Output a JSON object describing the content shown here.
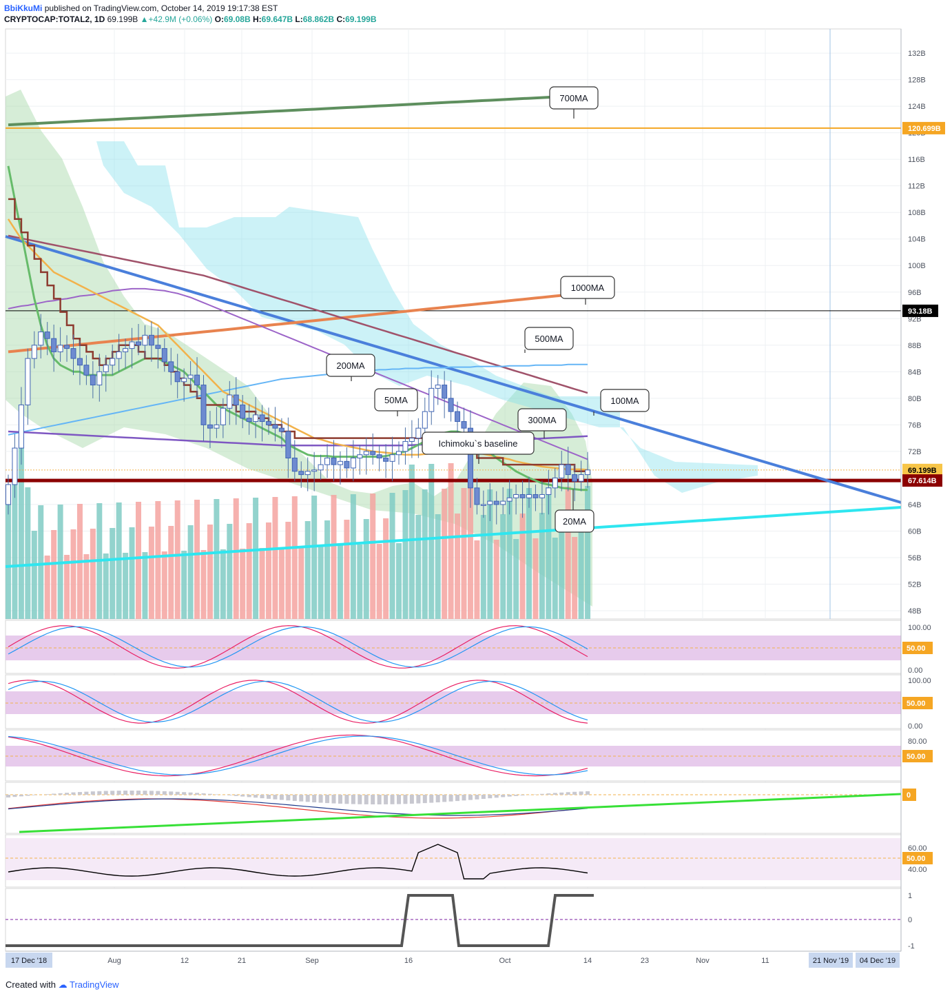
{
  "header": {
    "author": "BbiKkuMi",
    "published": "published on TradingView.com, October 14, 2019 19:17:38 EST",
    "symbol": "CRYPTOCAP:TOTAL2, 1D",
    "last": "69.199B",
    "change": "▲+42.9M (+0.06%)",
    "o_label": "O:",
    "o": "69.08B",
    "h_label": "H:",
    "h": "69.647B",
    "l_label": "L:",
    "l": "68.862B",
    "c_label": "C:",
    "c": "69.199B"
  },
  "footer": {
    "created_with": "Created with",
    "brand": "TradingView"
  },
  "colors": {
    "up": "#26a69a",
    "down": "#ef5350",
    "ma700": "#5e8f5e",
    "ma1000": "#e8834f",
    "ma500": "#a0526a",
    "ma200": "#64b5f6",
    "ma300": "#7e57c2",
    "ma100": "#9c64c8",
    "ma50": "#f2b24b",
    "ma20": "#66bb6a",
    "baseline": "#8d3b2f",
    "trend_blue": "#4a7fdb",
    "trend_cyan": "#2ee6f0",
    "trend_green": "#37e037",
    "orange_line": "#f5a623",
    "red_line": "#8b0000",
    "band": "#e1bee7"
  },
  "chart_data": {
    "type": "line",
    "y_axis_ticks": [
      "132B",
      "128B",
      "124B",
      "120B",
      "116B",
      "112B",
      "108B",
      "104B",
      "100B",
      "96B",
      "92B",
      "88B",
      "84B",
      "80B",
      "76B",
      "72B",
      "68B",
      "64B",
      "60B",
      "56B",
      "52B",
      "48B"
    ],
    "ylim": [
      47,
      133
    ],
    "x_axis_ticks": [
      "Aug",
      "12",
      "21",
      "Sep",
      "16",
      "Oct",
      "14",
      "23",
      "Nov",
      "11"
    ],
    "x_axis_boxes": [
      "17 Dec '18",
      "21 Nov '19",
      "04 Dec '19"
    ],
    "price_labels": {
      "horizontal_orange": "120.699B",
      "horizontal_black": "93.18B",
      "last_price": "69.199B",
      "horizontal_red": "67.614B"
    },
    "price_levels": {
      "horizontal_orange": 120.699,
      "horizontal_black": 93.18,
      "last_price": 69.199,
      "horizontal_red": 67.614
    },
    "annotations": [
      "700MA",
      "1000MA",
      "500MA",
      "200MA",
      "50MA",
      "100MA",
      "300MA",
      "Ichimoku`s baseline",
      "20MA"
    ],
    "close": [
      67.0,
      72.5,
      79.0,
      86.0,
      88.0,
      90.0,
      89.0,
      87.0,
      88.0,
      87.5,
      86.0,
      85.0,
      83.5,
      82.0,
      84.0,
      85.0,
      86.0,
      87.0,
      87.5,
      88.5,
      88.0,
      89.5,
      88.0,
      87.5,
      85.5,
      84.0,
      82.5,
      83.0,
      83.5,
      82.0,
      76.0,
      75.5,
      76.0,
      78.5,
      80.5,
      79.0,
      77.0,
      76.5,
      77.5,
      76.5,
      76.0,
      75.5,
      75.0,
      71.0,
      69.0,
      68.5,
      69.0,
      69.2,
      70.0,
      71.0,
      70.0,
      70.5,
      69.5,
      71.0,
      71.5,
      72.0,
      71.5,
      71.0,
      70.5,
      71.5,
      72.0,
      73.5,
      74.0,
      75.5,
      78.0,
      81.5,
      82.0,
      80.0,
      78.0,
      76.5,
      75.5,
      66.5,
      64.0,
      64.0,
      64.5,
      64.0,
      64.5,
      65.0,
      65.5,
      65.0,
      65.5,
      65.0,
      65.5,
      66.5,
      68.0,
      70.0,
      68.5,
      67.5,
      68.5,
      69.2
    ],
    "ma20": [
      115,
      110,
      105,
      100,
      95,
      91,
      88,
      86,
      85,
      84.5,
      84,
      84,
      83.5,
      83.5,
      83.5,
      83.5,
      83.5,
      84,
      84.5,
      85,
      85.5,
      86,
      86,
      86,
      85.5,
      85,
      84.5,
      84,
      83,
      82,
      81,
      80,
      79,
      78.5,
      78,
      77.5,
      77,
      76.5,
      76,
      75.5,
      75,
      74.5,
      74,
      73,
      72.5,
      72,
      71.5,
      71.3,
      71.3,
      71.3,
      71.2,
      71.2,
      71.2,
      71.2,
      71.2,
      71.2,
      71.2,
      71.2,
      71.3,
      71.5,
      71.8,
      72,
      72.5,
      73,
      73.5,
      74,
      74.5,
      74.8,
      75,
      75,
      74.7,
      74,
      73.3,
      72.5,
      71.8,
      71,
      70.3,
      69.7,
      69,
      68.5,
      68,
      67.6,
      67.2,
      67,
      66.8,
      66.5,
      66.4,
      66.3,
      66.2,
      66.2
    ],
    "ma50": [
      107,
      105.5,
      104,
      103,
      102,
      101,
      100,
      99,
      98.5,
      98,
      97.5,
      97,
      96.5,
      96,
      95.5,
      95,
      94.5,
      94,
      93.5,
      93,
      92.5,
      92,
      91.5,
      91,
      90,
      89,
      88,
      87,
      86,
      85,
      84,
      83,
      82,
      81,
      80.5,
      80,
      79.5,
      79,
      78.5,
      78,
      77.5,
      77,
      76.5,
      76,
      75.5,
      75,
      74.5,
      74,
      73.8,
      73.5,
      73.2,
      73,
      72.8,
      72.6,
      72.4,
      72.2,
      72,
      71.9,
      71.8,
      71.7,
      71.6,
      71.5,
      71.5,
      71.5,
      71.6,
      71.7,
      71.8,
      71.9,
      72,
      72,
      72,
      71.9,
      71.8,
      71.6,
      71.4,
      71.2,
      71,
      70.8,
      70.5,
      70.3,
      70.1,
      69.9,
      69.7,
      69.6,
      69.5,
      69.4,
      69.3,
      69.3,
      69.3,
      69.2
    ],
    "ma100": [
      93.5,
      93.7,
      93.9,
      94,
      94.2,
      94.4,
      94.6,
      94.7,
      94.9,
      95,
      95.2,
      95.4,
      95.5,
      95.6,
      95.8,
      96,
      96.2,
      96.3,
      96.4,
      96.5,
      96.5,
      96.5,
      96.4,
      96.3,
      96.2,
      96,
      95.8,
      95.5,
      95.2,
      94.8,
      94.4,
      94,
      93.6,
      93.2,
      92.8,
      92.4,
      92,
      91.6,
      91.2,
      90.8,
      90.4,
      90,
      89.6,
      89.2,
      88.8,
      88.4,
      88,
      87.6,
      87.2,
      86.8,
      86.4,
      86,
      85.6,
      85.2,
      84.8,
      84.4,
      84,
      83.6,
      83.2,
      82.8,
      82.4,
      82,
      81.6,
      81.2,
      80.8,
      80.4,
      80,
      79.6,
      79.2,
      78.8,
      78.4,
      78,
      77.6,
      77.2,
      76.8,
      76.4,
      76,
      75.6,
      75.2,
      74.8,
      74.4,
      74,
      73.6,
      73.2,
      72.8,
      72.4,
      72,
      71.6,
      71.2,
      70.8
    ],
    "ma200": [
      74.5,
      74.7,
      74.9,
      75.1,
      75.3,
      75.5,
      75.7,
      75.9,
      76.1,
      76.3,
      76.5,
      76.7,
      76.9,
      77.1,
      77.3,
      77.5,
      77.7,
      77.9,
      78.1,
      78.3,
      78.5,
      78.7,
      78.9,
      79.1,
      79.3,
      79.5,
      79.7,
      79.9,
      80.1,
      80.3,
      80.5,
      80.7,
      80.9,
      81.1,
      81.3,
      81.5,
      81.7,
      81.9,
      82.1,
      82.3,
      82.5,
      82.7,
      82.9,
      83.0,
      83.1,
      83.2,
      83.3,
      83.4,
      83.5,
      83.6,
      83.7,
      83.8,
      83.9,
      84.0,
      84.1,
      84.2,
      84.2,
      84.3,
      84.3,
      84.4,
      84.4,
      84.5,
      84.5,
      84.5,
      84.6,
      84.6,
      84.6,
      84.6,
      84.7,
      84.7,
      84.7,
      84.7,
      84.8,
      84.8,
      84.8,
      84.8,
      84.8,
      84.9,
      84.9,
      84.9,
      84.9,
      85.0,
      85.0,
      85.0,
      85.0,
      85.0,
      85.1,
      85.1,
      85.1,
      85.1
    ],
    "ma300": [
      75.0,
      74.95,
      74.9,
      74.85,
      74.8,
      74.75,
      74.7,
      74.65,
      74.6,
      74.55,
      74.5,
      74.45,
      74.4,
      74.35,
      74.3,
      74.25,
      74.2,
      74.15,
      74.1,
      74.05,
      74.0,
      73.95,
      73.9,
      73.85,
      73.8,
      73.75,
      73.7,
      73.65,
      73.6,
      73.55,
      73.5,
      73.45,
      73.4,
      73.35,
      73.3,
      73.25,
      73.2,
      73.15,
      73.1,
      73.05,
      73.0,
      72.95,
      72.9,
      72.9,
      72.9,
      72.9,
      72.9,
      72.9,
      72.9,
      72.9,
      72.9,
      72.9,
      72.9,
      72.9,
      72.9,
      72.9,
      72.9,
      72.9,
      72.9,
      72.9,
      72.9,
      72.9,
      72.95,
      73.0,
      73.05,
      73.1,
      73.15,
      73.2,
      73.25,
      73.3,
      73.35,
      73.4,
      73.45,
      73.5,
      73.55,
      73.6,
      73.65,
      73.7,
      73.75,
      73.8,
      73.85,
      73.9,
      73.95,
      74.0,
      74.05,
      74.1,
      74.15,
      74.2,
      74.25,
      74.3
    ],
    "ma500": [
      104.5,
      104.3,
      104.1,
      103.9,
      103.7,
      103.5,
      103.3,
      103.1,
      102.9,
      102.7,
      102.5,
      102.3,
      102.1,
      101.9,
      101.7,
      101.5,
      101.3,
      101.1,
      100.9,
      100.7,
      100.5,
      100.3,
      100.1,
      99.9,
      99.7,
      99.5,
      99.3,
      99.1,
      98.9,
      98.7,
      98.5,
      98.2,
      97.9,
      97.6,
      97.3,
      97.0,
      96.7,
      96.4,
      96.1,
      95.8,
      95.5,
      95.2,
      94.9,
      94.6,
      94.3,
      94.0,
      93.7,
      93.4,
      93.1,
      92.8,
      92.5,
      92.2,
      91.9,
      91.6,
      91.3,
      91.0,
      90.7,
      90.4,
      90.1,
      89.8,
      89.5,
      89.2,
      88.9,
      88.6,
      88.3,
      88.0,
      87.7,
      87.4,
      87.1,
      86.8,
      86.5,
      86.2,
      85.9,
      85.6,
      85.3,
      85.0,
      84.7,
      84.4,
      84.1,
      83.8,
      83.5,
      83.2,
      82.9,
      82.6,
      82.3,
      82.0,
      81.7,
      81.4,
      81.1,
      80.8
    ],
    "ma700": [
      121.2,
      121.25,
      121.3,
      121.35,
      121.4,
      121.45,
      121.5,
      121.55,
      121.6,
      121.65,
      121.7,
      121.75,
      121.8,
      121.85,
      121.9,
      121.95,
      122.0,
      122.05,
      122.1,
      122.15,
      122.2,
      122.25,
      122.3,
      122.35,
      122.4,
      122.45,
      122.5,
      122.55,
      122.6,
      122.65,
      122.7,
      122.75,
      122.8,
      122.85,
      122.9,
      122.95,
      123.0,
      123.05,
      123.1,
      123.15,
      123.2,
      123.25,
      123.3,
      123.35,
      123.4,
      123.45,
      123.5,
      123.55,
      123.6,
      123.65,
      123.7,
      123.75,
      123.8,
      123.85,
      123.9,
      123.95,
      124.0,
      124.05,
      124.1,
      124.15,
      124.2,
      124.25,
      124.3,
      124.35,
      124.4,
      124.45,
      124.5,
      124.55,
      124.6,
      124.65,
      124.7,
      124.75,
      124.8,
      124.85,
      124.9,
      124.95,
      125.0,
      125.05,
      125.1,
      125.15,
      125.2,
      125.25,
      125.3,
      125.35,
      125.4,
      125.45,
      125.5,
      125.55,
      125.6,
      125.65
    ],
    "ma1000": [
      87.0,
      87.1,
      87.2,
      87.3,
      87.4,
      87.5,
      87.6,
      87.7,
      87.8,
      87.9,
      88.0,
      88.1,
      88.2,
      88.3,
      88.4,
      88.5,
      88.6,
      88.7,
      88.8,
      88.9,
      89.0,
      89.1,
      89.2,
      89.3,
      89.4,
      89.5,
      89.6,
      89.7,
      89.8,
      89.9,
      90.0,
      90.1,
      90.2,
      90.3,
      90.4,
      90.5,
      90.6,
      90.7,
      90.8,
      90.9,
      91.0,
      91.1,
      91.2,
      91.3,
      91.4,
      91.5,
      91.6,
      91.7,
      91.8,
      91.9,
      92.0,
      92.1,
      92.2,
      92.3,
      92.4,
      92.5,
      92.6,
      92.7,
      92.8,
      92.9,
      93.0,
      93.1,
      93.2,
      93.3,
      93.4,
      93.5,
      93.6,
      93.7,
      93.8,
      93.9,
      94.0,
      94.1,
      94.2,
      94.3,
      94.4,
      94.5,
      94.6,
      94.7,
      94.8,
      94.9,
      95.0,
      95.1,
      95.2,
      95.3,
      95.4,
      95.5,
      95.6,
      95.7,
      95.8,
      95.9
    ],
    "baseline": [
      110,
      107,
      105,
      103,
      101,
      99,
      97,
      95,
      93,
      91,
      89,
      88,
      87,
      86,
      85,
      86,
      87,
      88,
      88,
      88,
      87,
      86,
      86,
      86,
      85,
      84,
      83,
      82,
      81,
      80,
      79,
      79,
      79,
      79,
      79,
      78,
      78,
      78,
      77,
      77,
      76,
      76,
      75,
      75,
      74,
      74,
      74,
      74,
      74,
      74,
      74,
      74,
      74,
      74,
      74,
      74,
      74,
      74,
      74,
      74,
      74,
      74,
      74,
      74,
      74,
      74,
      73,
      73,
      73,
      72,
      72,
      72,
      71,
      71,
      71,
      71,
      70,
      70,
      70,
      70,
      70,
      70,
      70,
      70,
      70,
      70,
      70,
      69,
      69,
      69
    ],
    "oscillators": [
      {
        "labels": [
          "100.00",
          "50.00",
          "0.00"
        ]
      },
      {
        "labels": [
          "100.00",
          "50.00",
          "0.00"
        ]
      },
      {
        "labels": [
          "80.00",
          "50.00"
        ]
      },
      {
        "labels": [
          "0"
        ]
      },
      {
        "labels": [
          "60.00",
          "50.00",
          "40.00"
        ]
      },
      {
        "labels": [
          "1",
          "0",
          "-1"
        ]
      }
    ]
  }
}
